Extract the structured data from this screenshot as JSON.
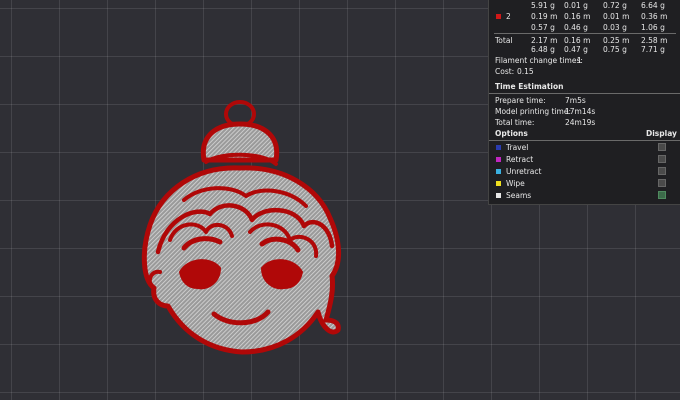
{
  "stats": {
    "rows": [
      {
        "id": "row-top",
        "swatch": null,
        "label": "",
        "c1": "5.91 g",
        "c2": "0.01 g",
        "c3": "0.72 g",
        "c4": "6.64 g"
      },
      {
        "id": "filament-2-length",
        "swatch": "#d01818",
        "label": "2",
        "c1": "0.19 m",
        "c2": "0.16 m",
        "c3": "0.01 m",
        "c4": "0.36 m"
      },
      {
        "id": "filament-2-weight",
        "swatch": null,
        "label": "",
        "c1": "0.57 g",
        "c2": "0.46 g",
        "c3": "0.03 g",
        "c4": "1.06 g"
      },
      {
        "id": "total-length",
        "swatch": null,
        "label": "Total",
        "c1": "2.17 m",
        "c2": "0.16 m",
        "c3": "0.25 m",
        "c4": "2.58 m"
      },
      {
        "id": "total-weight",
        "swatch": null,
        "label": "",
        "c1": "6.48 g",
        "c2": "0.47 g",
        "c3": "0.75 g",
        "c4": "7.71 g"
      }
    ],
    "filament_change": {
      "label": "Filament change times:",
      "value": "1"
    },
    "cost": {
      "label": "Cost:",
      "value": "0.15"
    }
  },
  "time_estimation": {
    "title": "Time Estimation",
    "prepare": {
      "label": "Prepare time:",
      "value": "7m5s"
    },
    "model_printing": {
      "label": "Model printing time:",
      "value": "17m14s"
    },
    "total": {
      "label": "Total time:",
      "value": "24m19s"
    }
  },
  "options": {
    "title": "Options",
    "display_label": "Display",
    "items": [
      {
        "label": "Travel",
        "color": "#2a3cb0",
        "checked": false
      },
      {
        "label": "Retract",
        "color": "#c026c0",
        "checked": false
      },
      {
        "label": "Unretract",
        "color": "#3ab0e0",
        "checked": false
      },
      {
        "label": "Wipe",
        "color": "#f0e020",
        "checked": false
      },
      {
        "label": "Seams",
        "color": "#e8e8e8",
        "checked": true
      }
    ]
  },
  "model": {
    "outline_color": "#b00808",
    "fill_color": "#b8b8b8"
  }
}
